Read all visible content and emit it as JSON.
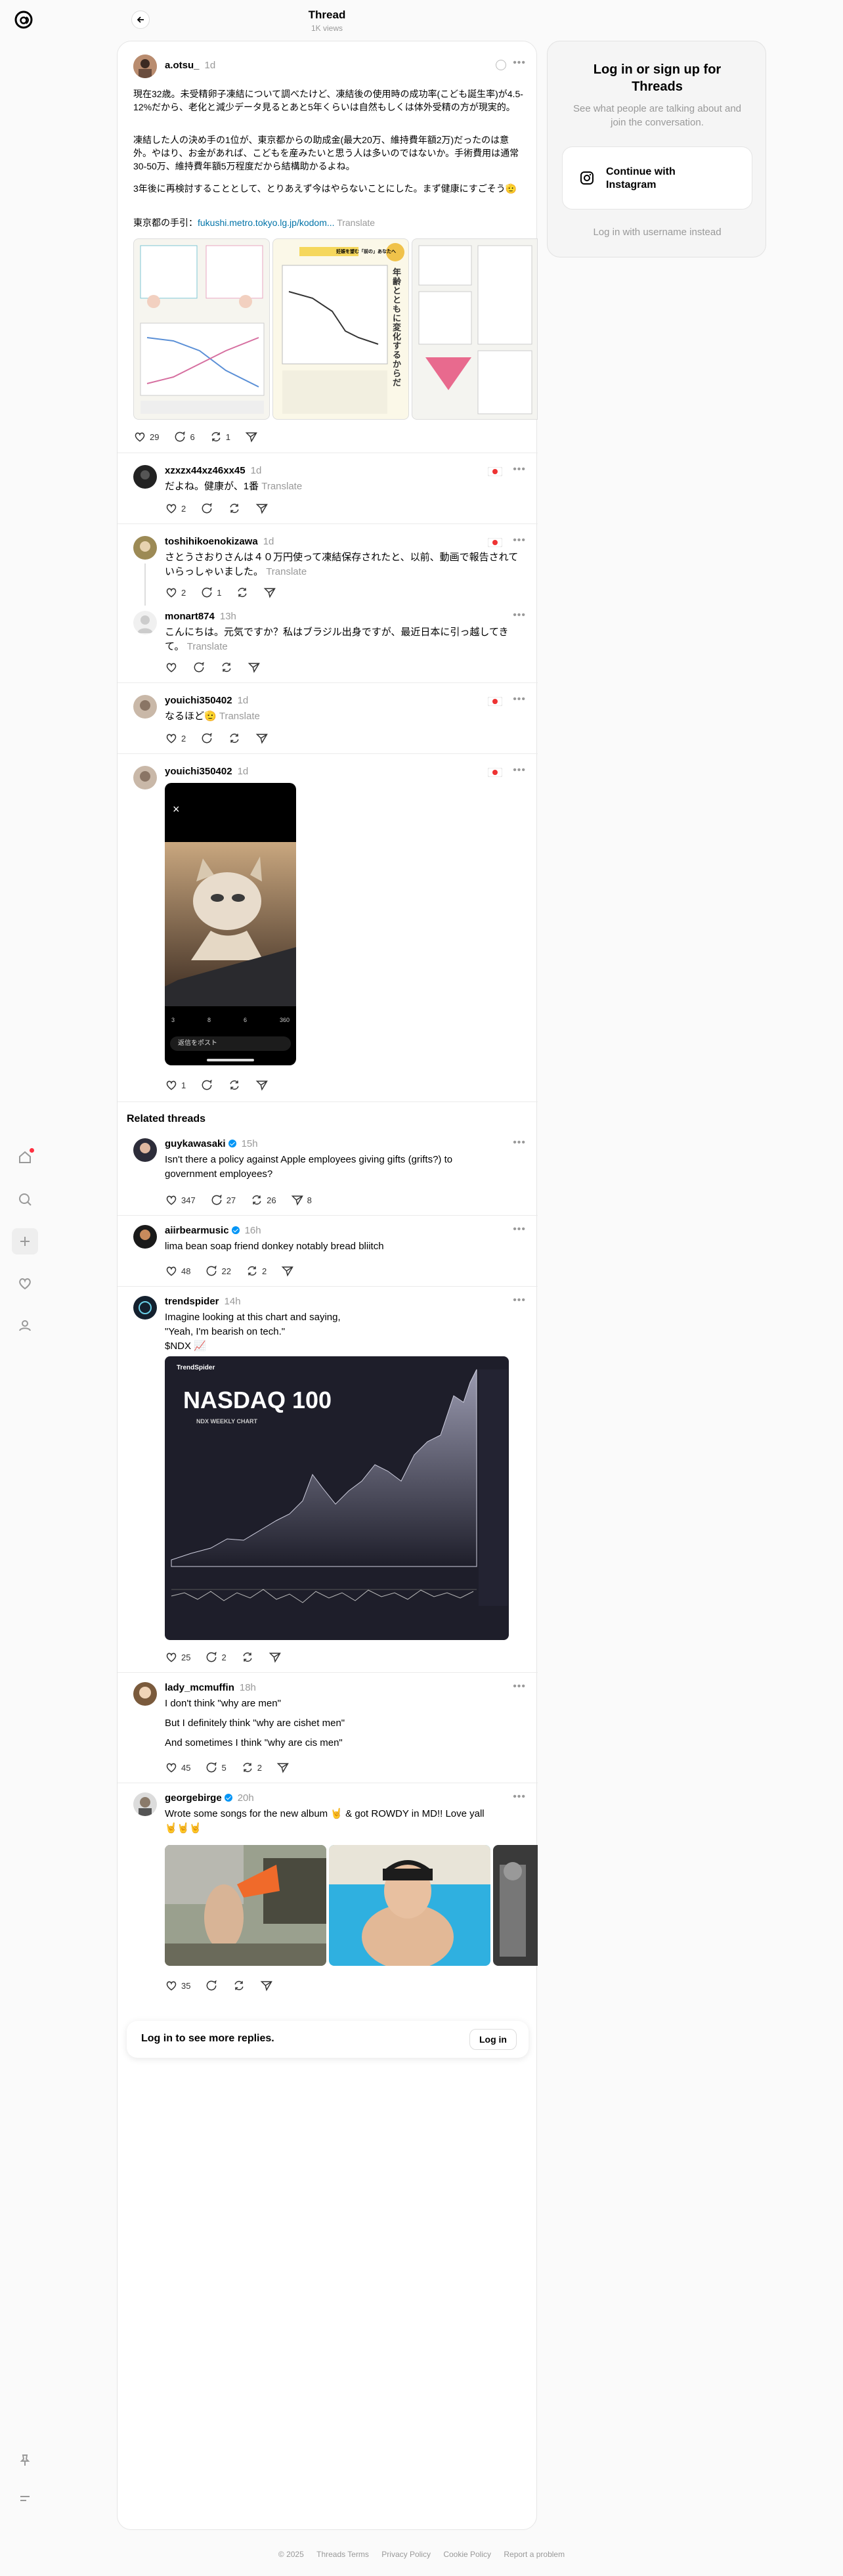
{
  "header": {
    "title": "Thread",
    "views": "1K views"
  },
  "main_post": {
    "username": "a.otsu_",
    "time": "1d",
    "paragraphs": [
      "現在32歳。未受精卵子凍結について調べたけど、凍結後の使用時の成功率(こども誕生率)が4.5-12%だから、老化と減少データ見るとあと5年くらいは自然もしくは体外受精の方が現実的。",
      "凍結した人の決め手の1位が、東京都からの助成金(最大20万、維持費年額2万)だったのは意外。やはり、お金があれば、こどもを産みたいと思う人は多いのではないか。手術費用は通常30-50万、維持費年額5万程度だから結構助かるよね。",
      "3年後に再検討することとして、とりあえず今はやらないことにした。まず健康にすごそう🫡"
    ],
    "source_prefix": "東京都の手引：",
    "source_link": "fukushi.metro.tokyo.lg.jp/kodom...",
    "translate": "Translate",
    "likes": "29",
    "replies": "6",
    "reposts": "1",
    "image2_title": "年齢とともに変化するからだ",
    "image2_heading": "妊娠を望む「前の」あなたへ"
  },
  "replies": [
    {
      "username": "xzxzx44xz46xx45",
      "time": "1d",
      "text": "だよね。健康が、1番",
      "translate": "Translate",
      "likes": "2"
    },
    {
      "username": "toshihikoenokizawa",
      "time": "1d",
      "text": "さとうさおりさんは４０万円使って凍結保存されたと、以前、動画で報告されていらっしゃいました。",
      "translate": "Translate",
      "likes": "2",
      "replies": "1"
    },
    {
      "username": "monart874",
      "time": "13h",
      "text": "こんにちは。元気ですか？私はブラジル出身ですが、最近日本に引っ越してきて。",
      "translate": "Translate"
    },
    {
      "username": "youichi350402",
      "time": "1d",
      "text": "なるほど🫡",
      "translate": "Translate",
      "likes": "2"
    },
    {
      "username": "youichi350402",
      "time": "1d",
      "likes": "1",
      "video": {
        "close": "×",
        "reply_box": "返信をポスト",
        "stat1": "3",
        "stat2": "8",
        "stat3": "6",
        "stat4": "360"
      }
    }
  ],
  "related_title": "Related threads",
  "related": [
    {
      "username": "guykawasaki",
      "verified": true,
      "time": "15h",
      "text": [
        "Isn't there a policy against Apple employees giving gifts (grifts?) to",
        "government employees?"
      ],
      "likes": "347",
      "replies": "27",
      "reposts": "26",
      "shares": "8"
    },
    {
      "username": "aiirbearmusic",
      "verified": true,
      "time": "16h",
      "text": [
        "lima bean soap friend donkey notably bread bliitch"
      ],
      "likes": "48",
      "replies": "22",
      "reposts": "2"
    },
    {
      "username": "trendspider",
      "verified": false,
      "time": "14h",
      "text": [
        "Imagine looking at this chart and saying,",
        "\"Yeah, I'm bearish on tech.\"",
        "$NDX 📈"
      ],
      "likes": "25",
      "replies": "2",
      "chart": {
        "brand": "TrendSpider",
        "title": "NASDAQ 100",
        "subtitle": "NDX WEEKLY CHART"
      }
    },
    {
      "username": "lady_mcmuffin",
      "verified": false,
      "time": "18h",
      "text": [
        "I don't think \"why are men\"",
        "But I definitely think \"why are cishet men\"",
        "And sometimes I think \"why are cis men\""
      ],
      "likes": "45",
      "replies": "5",
      "reposts": "2"
    },
    {
      "username": "georgebirge",
      "verified": true,
      "time": "20h",
      "text": [
        "Wrote some songs for the new album 🤘 & got ROWDY in MD!! Love yall",
        "🤘🤘🤘"
      ],
      "likes": "35"
    }
  ],
  "cta": {
    "text": "Log in to see more replies.",
    "button": "Log in"
  },
  "right_panel": {
    "title": "Log in or sign up for Threads",
    "subtitle": "See what people are talking about and join the conversation.",
    "ig_button": "Continue with Instagram",
    "username_login": "Log in with username instead"
  },
  "footer": [
    "© 2025",
    "Threads Terms",
    "Privacy Policy",
    "Cookie Policy",
    "Report a problem"
  ],
  "colors": {
    "accent": "#0095f6",
    "link": "#0073a8",
    "notification": "#ff3040"
  }
}
